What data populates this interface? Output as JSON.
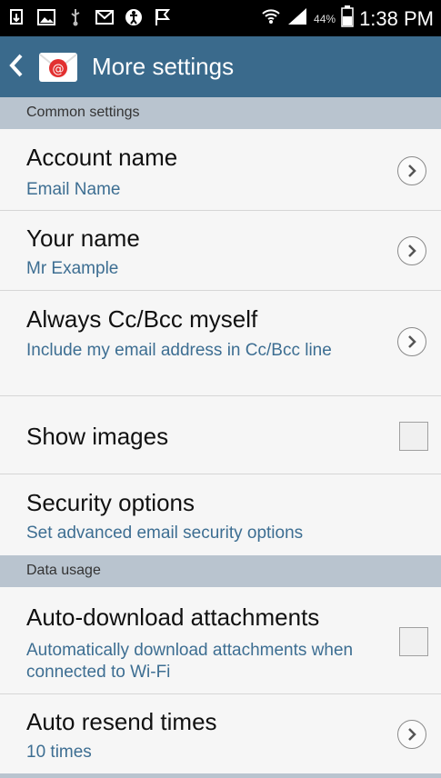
{
  "status_bar": {
    "icons": [
      "download-icon",
      "image-icon",
      "usb-icon",
      "mail-icon",
      "accessibility-icon",
      "flag-icon",
      "wifi-icon",
      "signal-icon",
      "battery-icon"
    ],
    "battery_percent": "44%",
    "time": "1:38 PM"
  },
  "action_bar": {
    "title": "More settings",
    "accent": "#3a6a8c"
  },
  "sections": {
    "common": "Common settings",
    "data_usage": "Data usage"
  },
  "items": {
    "account_name": {
      "title": "Account name",
      "subtitle": "Email Name"
    },
    "your_name": {
      "title": "Your name",
      "subtitle": "Mr Example"
    },
    "cc_bcc": {
      "title": "Always Cc/Bcc myself",
      "subtitle": "Include my email address in Cc/Bcc line"
    },
    "show_images": {
      "title": "Show images",
      "checked": false
    },
    "security": {
      "title": "Security options",
      "subtitle": "Set advanced email security options"
    },
    "auto_download": {
      "title": "Auto-download attachments",
      "subtitle": "Automatically download attachments when connected to Wi-Fi",
      "checked": false
    },
    "auto_resend": {
      "title": "Auto resend times",
      "subtitle": "10 times"
    }
  },
  "colors": {
    "section_bg": "#b9c4cf",
    "subtitle": "#3d6e92"
  }
}
